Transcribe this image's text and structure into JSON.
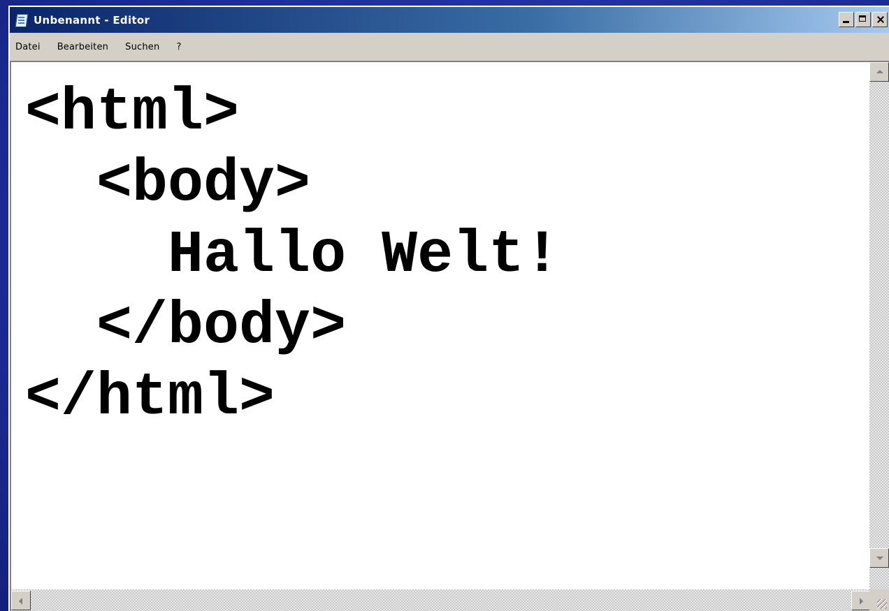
{
  "window": {
    "title": "Unbenannt - Editor",
    "icon": "notepad-icon",
    "buttons": [
      "minimize-icon",
      "maximize-icon",
      "close-icon"
    ]
  },
  "menu": {
    "items": [
      {
        "label": "Datei"
      },
      {
        "label": "Bearbeiten"
      },
      {
        "label": "Suchen"
      },
      {
        "label": "?"
      }
    ]
  },
  "editor": {
    "lines": [
      "<html>",
      "  <body>",
      "    Hallo Welt!",
      "  </body>",
      "</html>"
    ]
  },
  "colors": {
    "desktop": "#1d2f9c",
    "titlebar_start": "#0a246a",
    "titlebar_end": "#a6caf0",
    "chrome": "#d4d0c8",
    "text": "#000000"
  }
}
